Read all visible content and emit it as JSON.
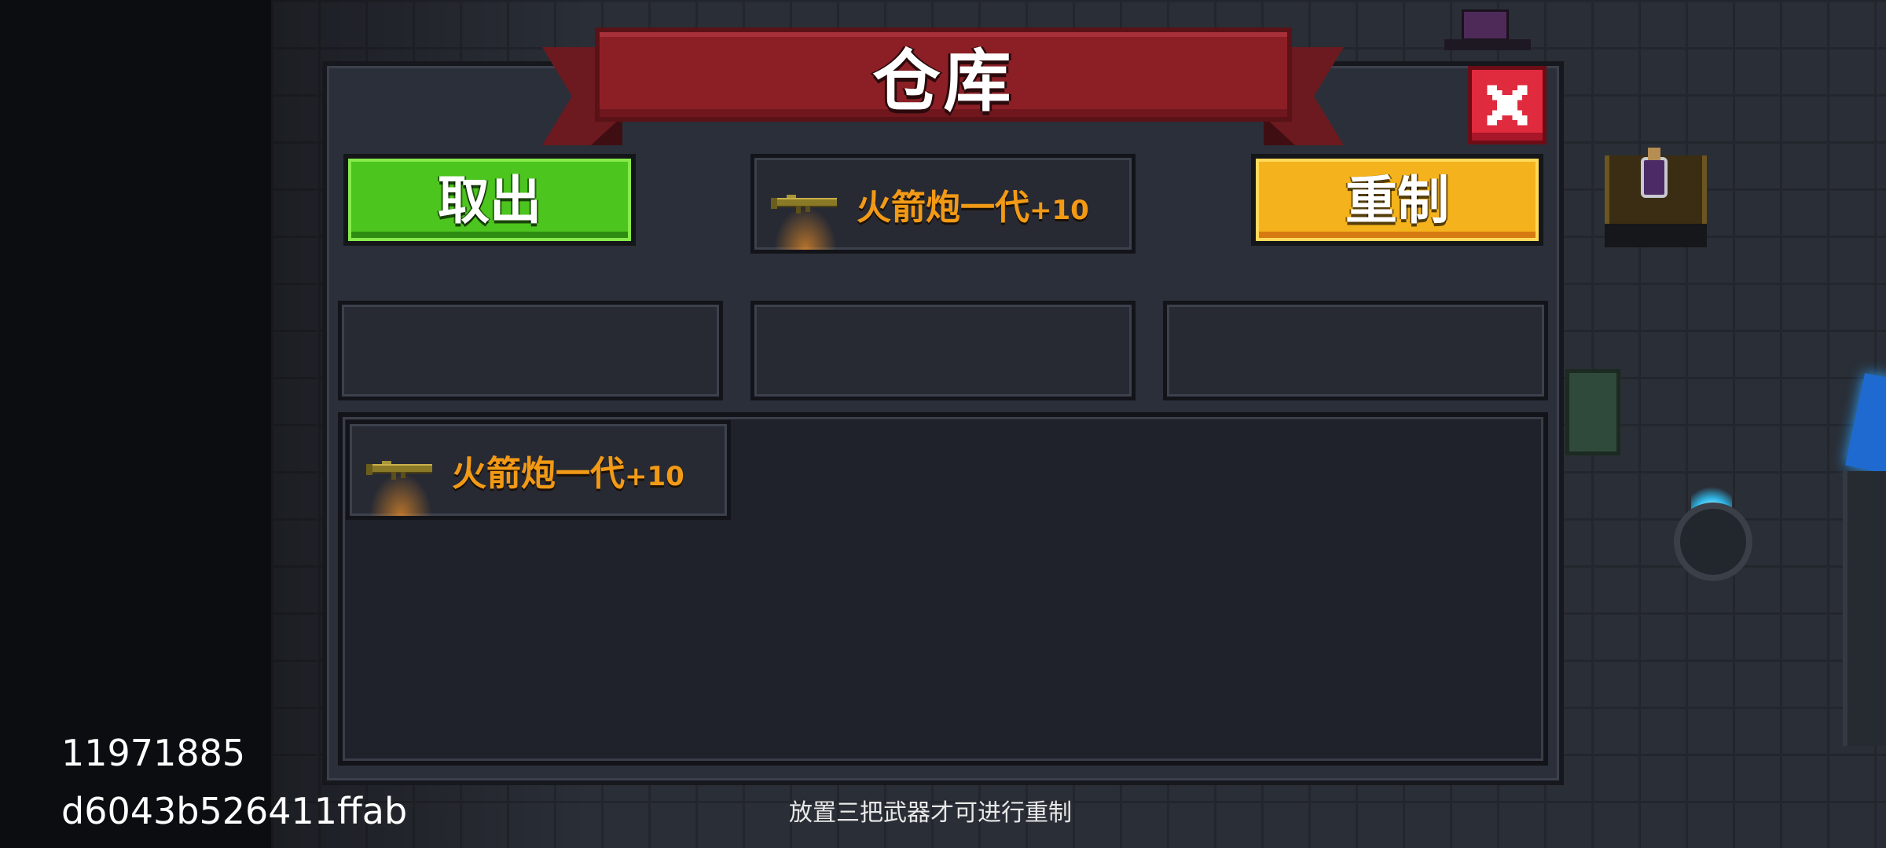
{
  "title": "仓库",
  "buttons": {
    "take_out": "取出",
    "reforge": "重制"
  },
  "selected_weapon": {
    "name": "火箭炮一代",
    "level": "+10",
    "icon": "rocket-launcher-icon"
  },
  "reforge_slots": [
    {
      "name": "",
      "level": ""
    },
    {
      "name": "",
      "level": ""
    },
    {
      "name": "",
      "level": ""
    }
  ],
  "inventory": [
    {
      "name": "火箭炮一代",
      "level": "+10",
      "icon": "rocket-launcher-icon"
    }
  ],
  "hint": "放置三把武器才可进行重制",
  "overlay": {
    "line1": "11971885",
    "line2": "d6043b526411ffab"
  },
  "colors": {
    "banner": "#8c1f26",
    "take_out_button": "#4cc51e",
    "reforge_button": "#f4b31c",
    "close_button": "#e02a3d",
    "weapon_text": "#f29a16"
  }
}
